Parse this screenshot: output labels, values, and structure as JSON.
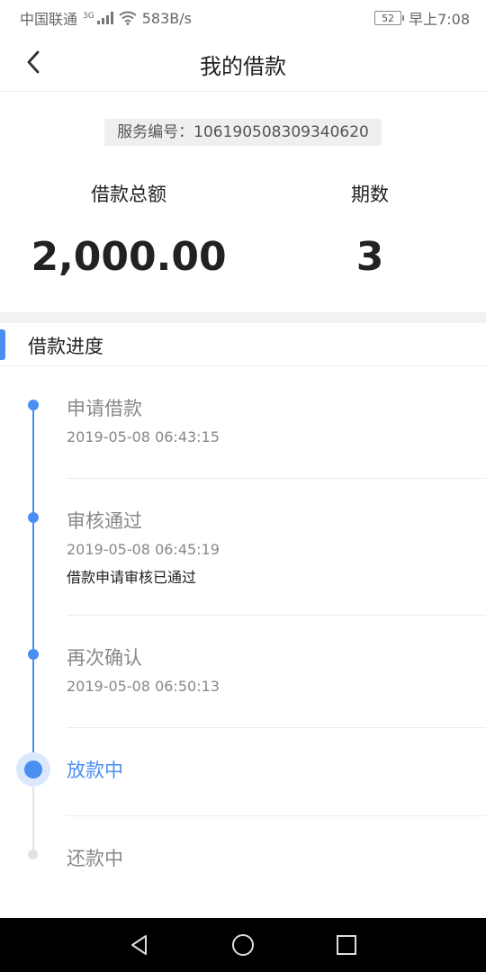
{
  "status_bar": {
    "carrier": "中国联通",
    "network_type": "3G",
    "speed": "583B/s",
    "battery": "52",
    "time": "早上7:08"
  },
  "header": {
    "title": "我的借款",
    "back_icon": "chevron-left-icon"
  },
  "summary": {
    "service_number": "服务编号：106190508309340620",
    "total_label": "借款总额",
    "total_value": "2,000.00",
    "periods_label": "期数",
    "periods_value": "3"
  },
  "progress": {
    "section_title": "借款进度",
    "accent_color": "#4a8ef2",
    "steps": [
      {
        "title": "申请借款",
        "time": "2019-05-08 06:43:15",
        "state": "done"
      },
      {
        "title": "审核通过",
        "time": "2019-05-08 06:45:19",
        "note": "借款申请审核已通过",
        "state": "done"
      },
      {
        "title": "再次确认",
        "time": "2019-05-08 06:50:13",
        "state": "done"
      },
      {
        "title": "放款中",
        "state": "current"
      },
      {
        "title": "还款中",
        "state": "pending"
      }
    ]
  },
  "system_nav": {
    "back": "triangle-back-icon",
    "home": "circle-home-icon",
    "recents": "square-recents-icon"
  }
}
